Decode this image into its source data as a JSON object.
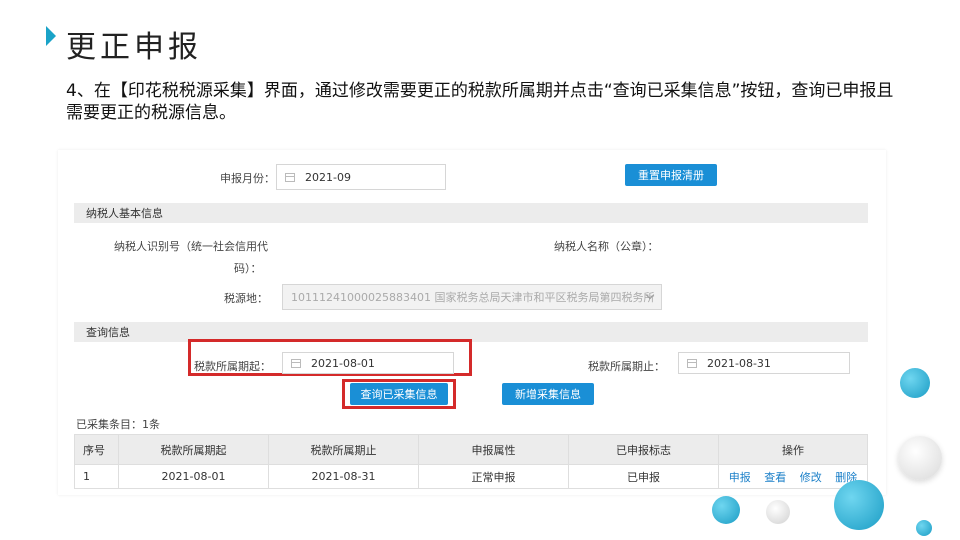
{
  "slide": {
    "title": "更正申报",
    "description": "4、在【印花税税源采集】界面，通过修改需要更正的税款所属期并点击“查询已采集信息”按钮，查询已申报且需要更正的税源信息。"
  },
  "form": {
    "declare_month_label": "申报月份：",
    "declare_month_value": "2021-09",
    "reset_button": "重置申报清册"
  },
  "taxpayer_section": {
    "title": "纳税人基本信息",
    "id_label_line1": "纳税人识别号（统一社会信用代",
    "id_label_line2": "码）：",
    "name_label": "纳税人名称（公章）：",
    "tax_authority_label": "税源地：",
    "tax_authority_value": "10111241000025883401 国家税务总局天津市和平区税务局第四税务所"
  },
  "query_section": {
    "title": "查询信息",
    "period_start_label": "税款所属期起：",
    "period_start_value": "2021-08-01",
    "period_end_label": "税款所属期止：",
    "period_end_value": "2021-08-31",
    "query_button": "查询已采集信息",
    "add_button": "新增采集信息"
  },
  "results": {
    "count_text": "已采集条目：1条",
    "columns": [
      "序号",
      "税款所属期起",
      "税款所属期止",
      "申报属性",
      "已申报标志",
      "操作"
    ],
    "rows": [
      {
        "index": "1",
        "period_start": "2021-08-01",
        "period_end": "2021-08-31",
        "attribute": "正常申报",
        "status": "已申报",
        "actions": [
          "申报",
          "查看",
          "修改",
          "删除"
        ]
      }
    ]
  },
  "colors": {
    "accent": "#1a8fd6",
    "highlight": "#d42a2a",
    "status_declared": "#38a11a",
    "decor": "#1aa3c8"
  }
}
